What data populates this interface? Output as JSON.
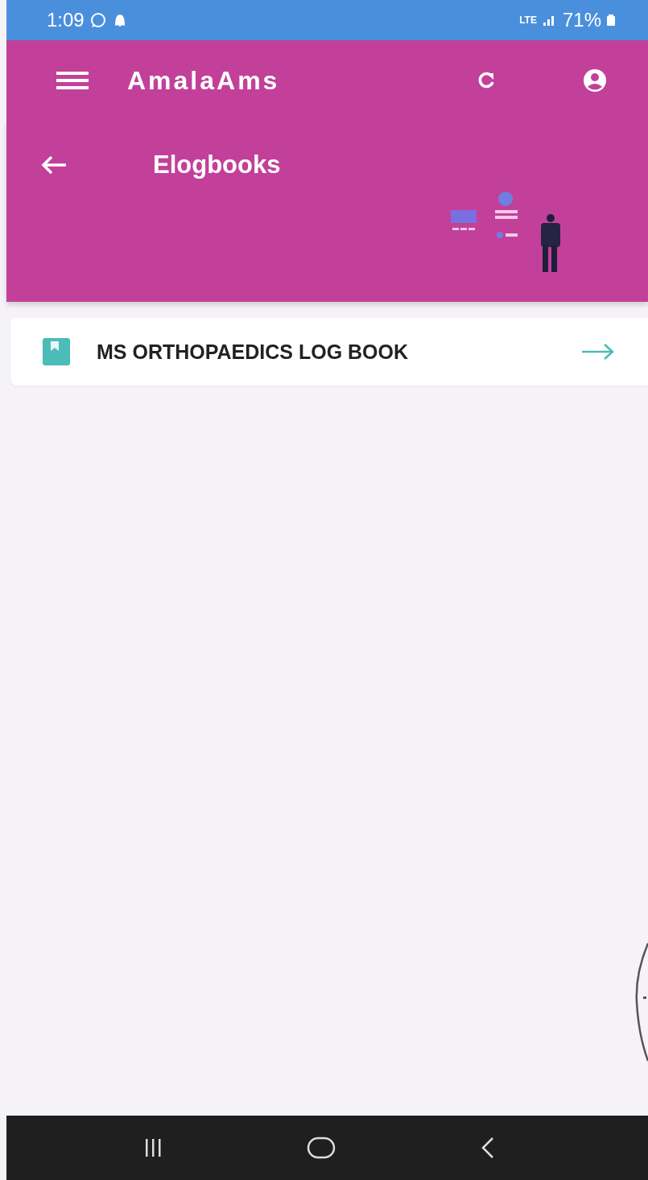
{
  "status_bar": {
    "time": "1:09",
    "network": "LTE",
    "battery": "71%"
  },
  "app_bar": {
    "title": "AmalaAms"
  },
  "header": {
    "title": "Elogbooks"
  },
  "logbooks": [
    {
      "title": "MS ORTHOPAEDICS LOG BOOK"
    }
  ]
}
